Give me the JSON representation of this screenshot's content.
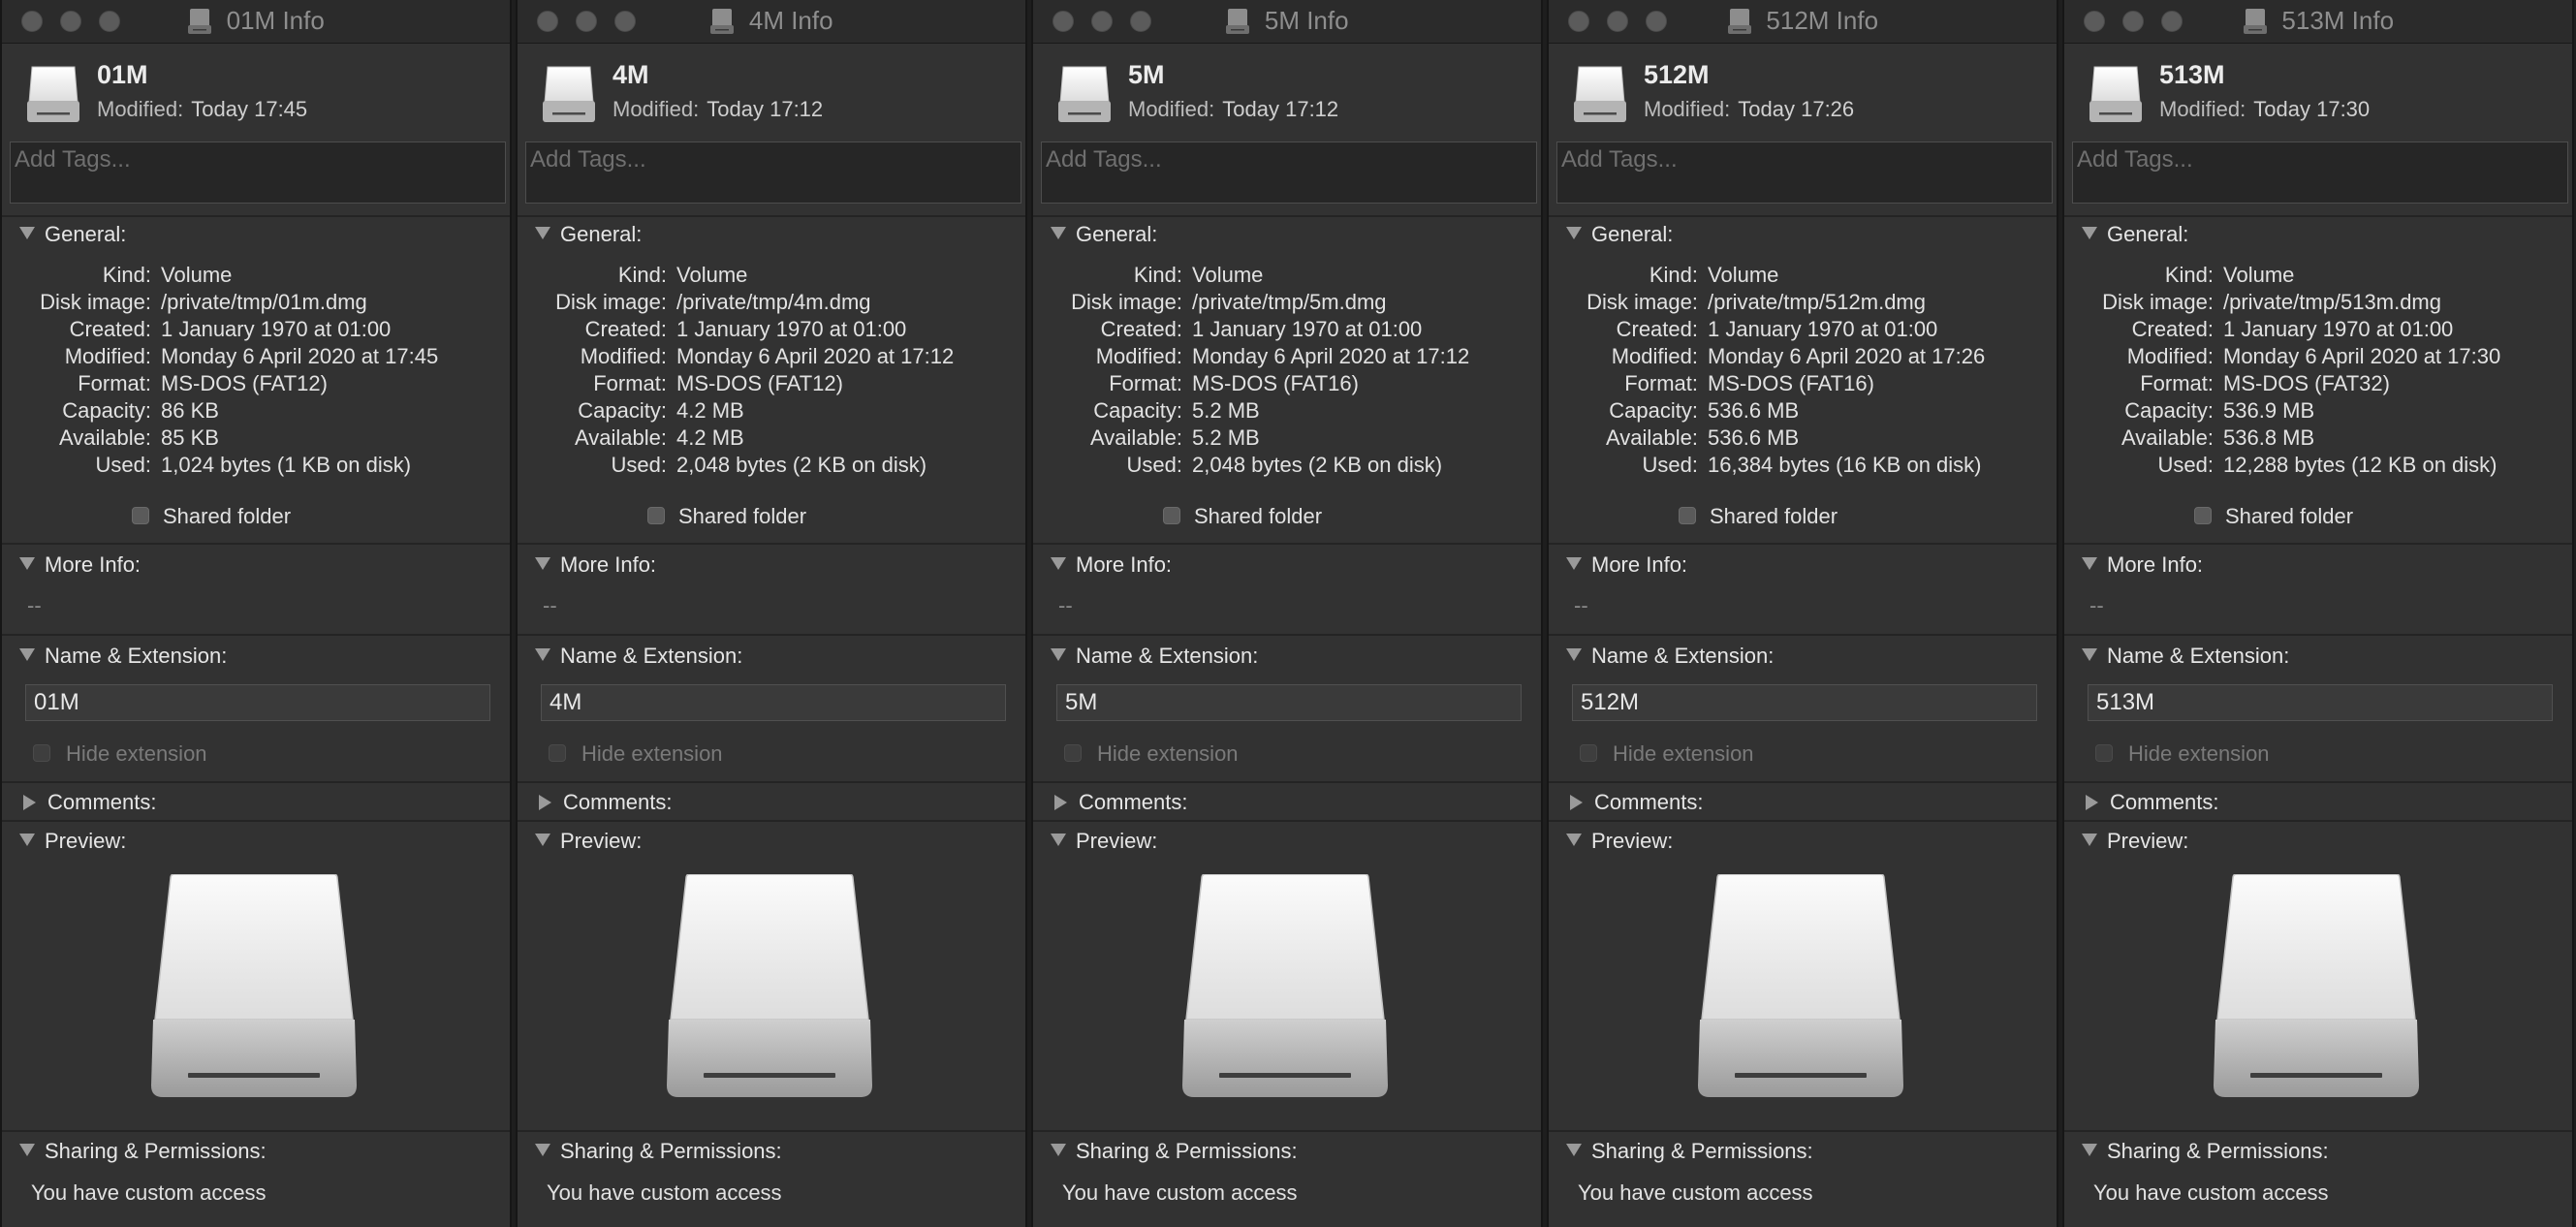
{
  "labels": {
    "modified": "Modified:",
    "tags_placeholder": "Add Tags...",
    "general": "General:",
    "kind": "Kind:",
    "disk_image": "Disk image:",
    "created": "Created:",
    "modified_row": "Modified:",
    "format": "Format:",
    "capacity": "Capacity:",
    "available": "Available:",
    "used": "Used:",
    "shared_folder": "Shared folder",
    "more_info": "More Info:",
    "more_info_empty": "--",
    "name_extension": "Name & Extension:",
    "hide_extension": "Hide extension",
    "comments": "Comments:",
    "preview": "Preview:",
    "sharing": "Sharing & Permissions:",
    "access": "You have custom access"
  },
  "windows": [
    {
      "title": "01M Info",
      "name": "01M",
      "modified_short": "Today 17:45",
      "kind": "Volume",
      "disk_image": "/private/tmp/01m.dmg",
      "created": "1 January 1970 at 01:00",
      "modified": "Monday 6 April 2020 at 17:45",
      "format": "MS-DOS (FAT12)",
      "capacity": "86 KB",
      "available": "85 KB",
      "used": "1,024 bytes (1 KB on disk)",
      "name_value": "01M"
    },
    {
      "title": "4M Info",
      "name": "4M",
      "modified_short": "Today 17:12",
      "kind": "Volume",
      "disk_image": "/private/tmp/4m.dmg",
      "created": "1 January 1970 at 01:00",
      "modified": "Monday 6 April 2020 at 17:12",
      "format": "MS-DOS (FAT12)",
      "capacity": "4.2 MB",
      "available": "4.2 MB",
      "used": "2,048 bytes (2 KB on disk)",
      "name_value": "4M"
    },
    {
      "title": "5M Info",
      "name": "5M",
      "modified_short": "Today 17:12",
      "kind": "Volume",
      "disk_image": "/private/tmp/5m.dmg",
      "created": "1 January 1970 at 01:00",
      "modified": "Monday 6 April 2020 at 17:12",
      "format": "MS-DOS (FAT16)",
      "capacity": "5.2 MB",
      "available": "5.2 MB",
      "used": "2,048 bytes (2 KB on disk)",
      "name_value": "5M"
    },
    {
      "title": "512M Info",
      "name": "512M",
      "modified_short": "Today 17:26",
      "kind": "Volume",
      "disk_image": "/private/tmp/512m.dmg",
      "created": "1 January 1970 at 01:00",
      "modified": "Monday 6 April 2020 at 17:26",
      "format": "MS-DOS (FAT16)",
      "capacity": "536.6 MB",
      "available": "536.6 MB",
      "used": "16,384 bytes (16 KB on disk)",
      "name_value": "512M"
    },
    {
      "title": "513M Info",
      "name": "513M",
      "modified_short": "Today 17:30",
      "kind": "Volume",
      "disk_image": "/private/tmp/513m.dmg",
      "created": "1 January 1970 at 01:00",
      "modified": "Monday 6 April 2020 at 17:30",
      "format": "MS-DOS (FAT32)",
      "capacity": "536.9 MB",
      "available": "536.8 MB",
      "used": "12,288 bytes (12 KB on disk)",
      "name_value": "513M"
    }
  ]
}
